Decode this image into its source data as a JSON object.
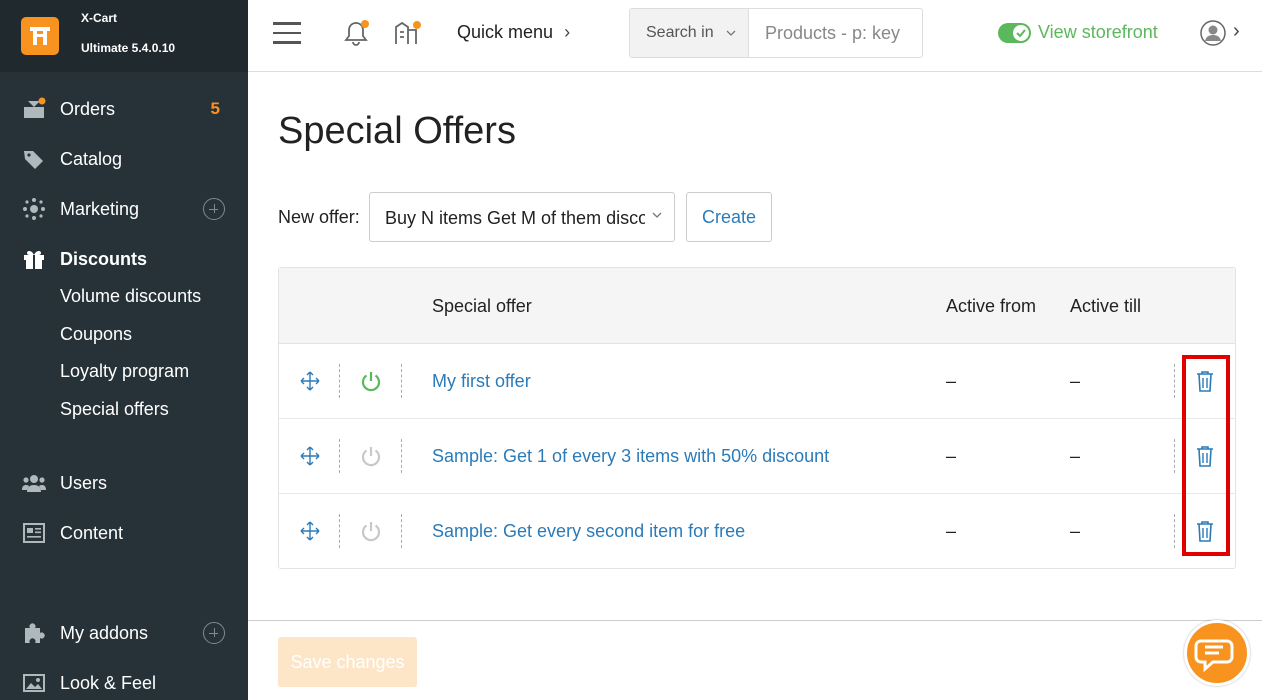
{
  "brand": {
    "name": "X-Cart",
    "edition": "Ultimate 5.4.0.10"
  },
  "sidebar": {
    "items": [
      {
        "label": "Orders",
        "badge": "5"
      },
      {
        "label": "Catalog"
      },
      {
        "label": "Marketing"
      },
      {
        "label": "Discounts"
      },
      {
        "label": "Users"
      },
      {
        "label": "Content"
      },
      {
        "label": "My addons"
      },
      {
        "label": "Look & Feel"
      }
    ],
    "discounts_sub": [
      "Volume discounts",
      "Coupons",
      "Loyalty program",
      "Special offers"
    ]
  },
  "header": {
    "quick_menu": "Quick menu",
    "search_in": "Search in",
    "search_placeholder": "Products - p: key",
    "view_storefront": "View storefront"
  },
  "main": {
    "title": "Special Offers",
    "new_offer_label": "New offer:",
    "new_offer_selected": "Buy N items Get M of them discounted",
    "create_label": "Create",
    "table": {
      "columns": [
        "Special offer",
        "Active from",
        "Active till"
      ],
      "rows": [
        {
          "name": "My first offer",
          "active_from": "–",
          "active_till": "–",
          "enabled": true
        },
        {
          "name": "Sample: Get 1 of every 3 items with 50% discount",
          "active_from": "–",
          "active_till": "–",
          "enabled": false
        },
        {
          "name": "Sample: Get every second item for free",
          "active_from": "–",
          "active_till": "–",
          "enabled": false
        }
      ]
    }
  },
  "footer": {
    "save_label": "Save changes"
  },
  "colors": {
    "accent": "#f7931e",
    "link": "#2b7bb9",
    "sidebar_bg": "#263238",
    "success": "#5cb85c",
    "highlight": "#e00000"
  }
}
